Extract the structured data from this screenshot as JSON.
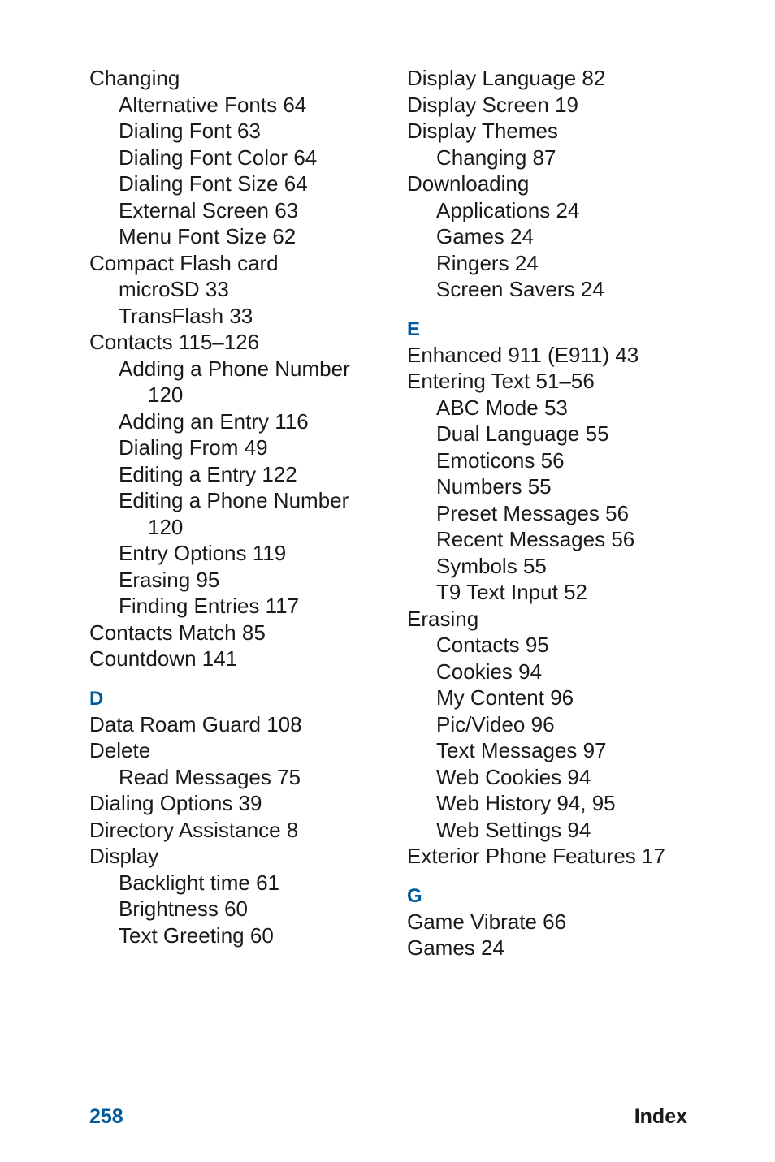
{
  "left": [
    {
      "l": 0,
      "t": "Changing",
      "p": ""
    },
    {
      "l": 1,
      "t": "Alternative Fonts",
      "p": "64"
    },
    {
      "l": 1,
      "t": "Dialing Font",
      "p": "63"
    },
    {
      "l": 1,
      "t": "Dialing Font Color",
      "p": "64"
    },
    {
      "l": 1,
      "t": "Dialing Font Size",
      "p": "64"
    },
    {
      "l": 1,
      "t": "External Screen",
      "p": "63"
    },
    {
      "l": 1,
      "t": "Menu Font Size",
      "p": "62"
    },
    {
      "l": 0,
      "t": "Compact Flash card",
      "p": ""
    },
    {
      "l": 1,
      "t": "microSD",
      "p": "33"
    },
    {
      "l": 1,
      "t": "TransFlash",
      "p": "33"
    },
    {
      "l": 0,
      "t": "Contacts",
      "p": "115–126"
    },
    {
      "l": 1,
      "t": "Adding a Phone Number",
      "p": ""
    },
    {
      "l": 2,
      "t": "120",
      "p": ""
    },
    {
      "l": 1,
      "t": "Adding an Entry",
      "p": "116"
    },
    {
      "l": 1,
      "t": "Dialing From",
      "p": "49"
    },
    {
      "l": 1,
      "t": "Editing a Entry",
      "p": "122"
    },
    {
      "l": 1,
      "t": "Editing a Phone Number",
      "p": ""
    },
    {
      "l": 2,
      "t": "120",
      "p": ""
    },
    {
      "l": 1,
      "t": "Entry Options",
      "p": "119"
    },
    {
      "l": 1,
      "t": "Erasing",
      "p": "95"
    },
    {
      "l": 1,
      "t": "Finding Entries",
      "p": "117"
    },
    {
      "l": 0,
      "t": "Contacts Match",
      "p": "85"
    },
    {
      "l": 0,
      "t": "Countdown",
      "p": "141"
    },
    {
      "letter": "D"
    },
    {
      "l": 0,
      "t": "Data Roam Guard",
      "p": "108"
    },
    {
      "l": 0,
      "t": "Delete",
      "p": ""
    },
    {
      "l": 1,
      "t": "Read Messages",
      "p": "75"
    },
    {
      "l": 0,
      "t": "Dialing Options",
      "p": "39"
    },
    {
      "l": 0,
      "t": "Directory Assistance",
      "p": "8"
    },
    {
      "l": 0,
      "t": "Display",
      "p": ""
    },
    {
      "l": 1,
      "t": "Backlight time",
      "p": "61"
    },
    {
      "l": 1,
      "t": "Brightness",
      "p": "60"
    },
    {
      "l": 1,
      "t": "Text Greeting",
      "p": "60"
    }
  ],
  "right": [
    {
      "l": 0,
      "t": "Display Language",
      "p": "82"
    },
    {
      "l": 0,
      "t": "Display Screen",
      "p": "19"
    },
    {
      "l": 0,
      "t": "Display Themes",
      "p": ""
    },
    {
      "l": 1,
      "t": "Changing",
      "p": "87"
    },
    {
      "l": 0,
      "t": "Downloading",
      "p": ""
    },
    {
      "l": 1,
      "t": "Applications",
      "p": "24"
    },
    {
      "l": 1,
      "t": "Games",
      "p": "24"
    },
    {
      "l": 1,
      "t": "Ringers",
      "p": "24"
    },
    {
      "l": 1,
      "t": "Screen Savers",
      "p": "24"
    },
    {
      "letter": "E"
    },
    {
      "l": 0,
      "t": "Enhanced 911 (E911)",
      "p": "43"
    },
    {
      "l": 0,
      "t": "Entering Text",
      "p": "51–56"
    },
    {
      "l": 1,
      "t": "ABC Mode",
      "p": "53"
    },
    {
      "l": 1,
      "t": "Dual Language",
      "p": "55"
    },
    {
      "l": 1,
      "t": "Emoticons",
      "p": "56"
    },
    {
      "l": 1,
      "t": "Numbers",
      "p": "55"
    },
    {
      "l": 1,
      "t": "Preset Messages",
      "p": "56"
    },
    {
      "l": 1,
      "t": "Recent Messages",
      "p": "56"
    },
    {
      "l": 1,
      "t": "Symbols",
      "p": "55"
    },
    {
      "l": 1,
      "t": "T9 Text Input",
      "p": "52"
    },
    {
      "l": 0,
      "t": "Erasing",
      "p": ""
    },
    {
      "l": 1,
      "t": "Contacts",
      "p": "95"
    },
    {
      "l": 1,
      "t": "Cookies",
      "p": "94"
    },
    {
      "l": 1,
      "t": "My Content",
      "p": "96"
    },
    {
      "l": 1,
      "t": "Pic/Video",
      "p": "96"
    },
    {
      "l": 1,
      "t": "Text Messages",
      "p": "97"
    },
    {
      "l": 1,
      "t": "Web Cookies",
      "p": "94"
    },
    {
      "l": 1,
      "t": "Web History",
      "p": "94, 95"
    },
    {
      "l": 1,
      "t": "Web Settings",
      "p": "94"
    },
    {
      "l": 0,
      "t": "Exterior Phone Features",
      "p": "17"
    },
    {
      "letter": "G"
    },
    {
      "l": 0,
      "t": "Game Vibrate",
      "p": "66"
    },
    {
      "l": 0,
      "t": "Games",
      "p": "24"
    }
  ],
  "footer": {
    "page": "258",
    "label": "Index"
  }
}
